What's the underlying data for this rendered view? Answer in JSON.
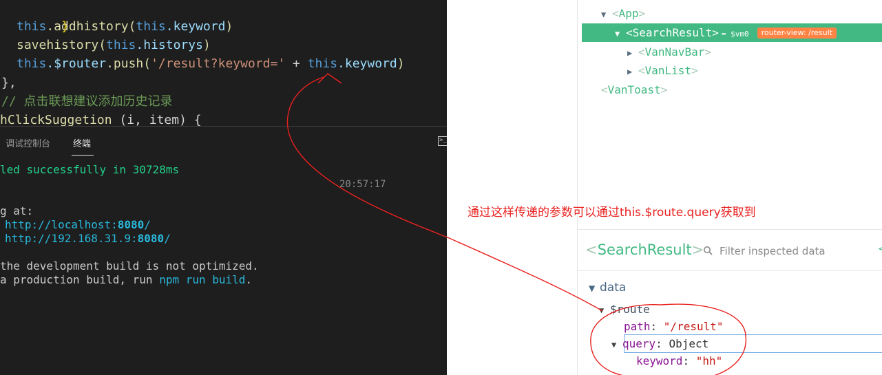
{
  "editor": {
    "line1": {
      "brace": "}"
    },
    "line2": {
      "this": "this",
      "fn": ".addhistory(",
      "this2": "this",
      "prop": ".keyword",
      "close": ")"
    },
    "line3": {
      "fn": "savehistory(",
      "this": "this",
      "prop": ".historys",
      "close": ")"
    },
    "line4": {
      "this": "this",
      "prop": ".$router",
      "fn": ".push(",
      "str": "'/result?keyword='",
      "plus": " + ",
      "this2": "this",
      "prop2": ".keyword",
      "close": ")"
    },
    "line5": {
      "text": "},",
      "indent": ""
    },
    "line6": {
      "comment": "// 点击联想建议添加历史记录"
    },
    "line7": {
      "fn": "hClickSuggetion",
      "args": " (i, item) {"
    }
  },
  "panel": {
    "tab_debug": "调试控制台",
    "tab_terminal": "终端",
    "terminal_icon": "terminal-icon"
  },
  "terminal": {
    "compiled": "led successfully in 30728ms",
    "time": "20:57:17",
    "running": "g at:",
    "local_prefix": "http://localhost:",
    "local_port": "8080",
    "local_suffix": "/",
    "net_prefix": "http://192.168.31.9:",
    "net_port": "8080",
    "net_suffix": "/",
    "note1": "the development build is not optimized.",
    "note2_a": "a production build, run ",
    "note2_cmd": "npm run build",
    "note2_b": "."
  },
  "tree": {
    "app": "App",
    "selected": "SearchResult",
    "vm": "= $vm0",
    "badge": "router-view: /result",
    "child1": "VanNavBar",
    "child2": "VanList",
    "toast": "VanToast"
  },
  "annotation": "通过这样传递的参数可以通过this.$route.query获取到",
  "inspector": {
    "title": "SearchResult",
    "filter_placeholder": "Filter inspected data",
    "more": "<",
    "section": "data",
    "route_key": "$route",
    "path_key": "path",
    "path_val": "\"/result\"",
    "query_key": "query",
    "query_val": "Object",
    "keyword_key": "keyword",
    "keyword_val": "\"hh\""
  },
  "colors": {
    "vue_green": "#42b983",
    "badge_orange": "#ff8344",
    "annotation_red": "#e8211f"
  }
}
